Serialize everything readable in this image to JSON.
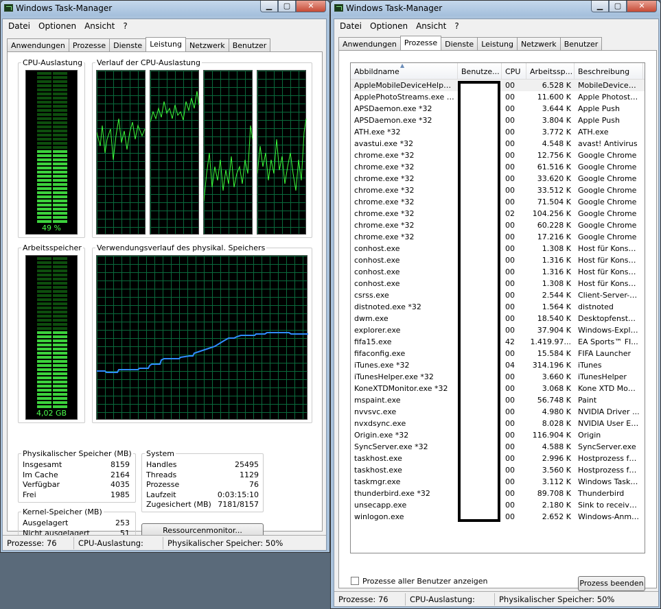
{
  "left_window": {
    "title": "Windows Task-Manager",
    "menu": [
      "Datei",
      "Optionen",
      "Ansicht",
      "?"
    ],
    "tabs": [
      "Anwendungen",
      "Prozesse",
      "Dienste",
      "Leistung",
      "Netzwerk",
      "Benutzer"
    ],
    "active_tab": "Leistung",
    "cpu_usage_label": "CPU-Auslastung",
    "cpu_usage_value": "49 %",
    "cpu_usage_percent": 49,
    "cpu_history_label": "Verlauf der CPU-Auslastung",
    "memory_label": "Arbeitsspeicher",
    "memory_value": "4,02 GB",
    "memory_percent": 50,
    "memory_history_label": "Verwendungsverlauf des physikal. Speichers",
    "physical_memory": {
      "title": "Physikalischer Speicher (MB)",
      "rows": [
        {
          "label": "Insgesamt",
          "value": "8159"
        },
        {
          "label": "Im Cache",
          "value": "2164"
        },
        {
          "label": "Verfügbar",
          "value": "4035"
        },
        {
          "label": "Frei",
          "value": "1985"
        }
      ]
    },
    "kernel_memory": {
      "title": "Kernel-Speicher (MB)",
      "rows": [
        {
          "label": "Ausgelagert",
          "value": "253"
        },
        {
          "label": "Nicht ausgelagert",
          "value": "51"
        }
      ]
    },
    "system": {
      "title": "System",
      "rows": [
        {
          "label": "Handles",
          "value": "25495"
        },
        {
          "label": "Threads",
          "value": "1129"
        },
        {
          "label": "Prozesse",
          "value": "76"
        },
        {
          "label": "Laufzeit",
          "value": "0:03:15:10"
        },
        {
          "label": "Zugesichert (MB)",
          "value": "7181/8157"
        }
      ]
    },
    "resource_monitor_button": "Ressourcenmonitor...",
    "status": {
      "processes": "Prozesse: 76",
      "cpu": "CPU-Auslastung: 49%",
      "memory": "Physikalischer Speicher: 50%"
    }
  },
  "right_window": {
    "title": "Windows Task-Manager",
    "menu": [
      "Datei",
      "Optionen",
      "Ansicht",
      "?"
    ],
    "tabs": [
      "Anwendungen",
      "Prozesse",
      "Dienste",
      "Leistung",
      "Netzwerk",
      "Benutzer"
    ],
    "active_tab": "Prozesse",
    "columns": [
      "Abbildname",
      "Benutze...",
      "CPU",
      "Arbeitssp...",
      "Beschreibung"
    ],
    "processes": [
      [
        "AppleMobileDeviceHelper.e...",
        "",
        "00",
        "6.528 K",
        "MobileDeviceHe..."
      ],
      [
        "ApplePhotoStreams.exe *32",
        "",
        "00",
        "11.600 K",
        "Apple Photostr..."
      ],
      [
        "APSDaemon.exe *32",
        "",
        "00",
        "3.644 K",
        "Apple Push"
      ],
      [
        "APSDaemon.exe *32",
        "",
        "00",
        "3.804 K",
        "Apple Push"
      ],
      [
        "ATH.exe *32",
        "",
        "00",
        "3.772 K",
        "ATH.exe"
      ],
      [
        "avastui.exe *32",
        "",
        "00",
        "4.548 K",
        "avast! Antivirus"
      ],
      [
        "chrome.exe *32",
        "",
        "00",
        "12.756 K",
        "Google Chrome"
      ],
      [
        "chrome.exe *32",
        "",
        "00",
        "61.516 K",
        "Google Chrome"
      ],
      [
        "chrome.exe *32",
        "",
        "00",
        "33.620 K",
        "Google Chrome"
      ],
      [
        "chrome.exe *32",
        "",
        "00",
        "33.512 K",
        "Google Chrome"
      ],
      [
        "chrome.exe *32",
        "",
        "00",
        "71.504 K",
        "Google Chrome"
      ],
      [
        "chrome.exe *32",
        "",
        "02",
        "104.256 K",
        "Google Chrome"
      ],
      [
        "chrome.exe *32",
        "",
        "00",
        "60.228 K",
        "Google Chrome"
      ],
      [
        "chrome.exe *32",
        "",
        "00",
        "17.216 K",
        "Google Chrome"
      ],
      [
        "conhost.exe",
        "",
        "00",
        "1.308 K",
        "Host für Konsol..."
      ],
      [
        "conhost.exe",
        "",
        "00",
        "1.316 K",
        "Host für Konsol..."
      ],
      [
        "conhost.exe",
        "",
        "00",
        "1.316 K",
        "Host für Konsol..."
      ],
      [
        "conhost.exe",
        "",
        "00",
        "1.308 K",
        "Host für Konsol..."
      ],
      [
        "csrss.exe",
        "",
        "00",
        "2.544 K",
        "Client-Server-L..."
      ],
      [
        "distnoted.exe *32",
        "",
        "00",
        "1.564 K",
        "distnoted"
      ],
      [
        "dwm.exe",
        "",
        "00",
        "18.540 K",
        "Desktopfenster..."
      ],
      [
        "explorer.exe",
        "",
        "00",
        "37.904 K",
        "Windows-Explorer"
      ],
      [
        "fifa15.exe",
        "",
        "42",
        "1.419.97...",
        "EA Sports™ FI..."
      ],
      [
        "fifaconfig.exe",
        "",
        "00",
        "15.584 K",
        "FIFA Launcher"
      ],
      [
        "iTunes.exe *32",
        "",
        "04",
        "314.196 K",
        "iTunes"
      ],
      [
        "iTunesHelper.exe *32",
        "",
        "00",
        "3.660 K",
        "iTunesHelper"
      ],
      [
        "KoneXTDMonitor.exe *32",
        "",
        "00",
        "3.068 K",
        "Kone XTD Monit..."
      ],
      [
        "mspaint.exe",
        "",
        "00",
        "56.748 K",
        "Paint"
      ],
      [
        "nvvsvc.exe",
        "",
        "00",
        "4.980 K",
        "NVIDIA Driver ..."
      ],
      [
        "nvxdsync.exe",
        "",
        "00",
        "8.028 K",
        "NVIDIA User Ex..."
      ],
      [
        "Origin.exe *32",
        "",
        "00",
        "116.904 K",
        "Origin"
      ],
      [
        "SyncServer.exe *32",
        "",
        "00",
        "4.588 K",
        "SyncServer.exe"
      ],
      [
        "taskhost.exe",
        "",
        "00",
        "2.996 K",
        "Hostprozess fü..."
      ],
      [
        "taskhost.exe",
        "",
        "00",
        "3.560 K",
        "Hostprozess fü..."
      ],
      [
        "taskmgr.exe",
        "",
        "00",
        "3.112 K",
        "Windows Task-..."
      ],
      [
        "thunderbird.exe *32",
        "",
        "00",
        "89.708 K",
        "Thunderbird"
      ],
      [
        "unsecapp.exe",
        "",
        "00",
        "2.180 K",
        "Sink to receive ..."
      ],
      [
        "winlogon.exe",
        "",
        "00",
        "2.652 K",
        "Windows-Anme..."
      ]
    ],
    "show_all_users_label": "Prozesse aller Benutzer anzeigen",
    "end_process_button": "Prozess beenden",
    "status": {
      "processes": "Prozesse: 76",
      "cpu": "CPU-Auslastung: 50%",
      "memory": "Physikalischer Speicher: 50%"
    }
  }
}
